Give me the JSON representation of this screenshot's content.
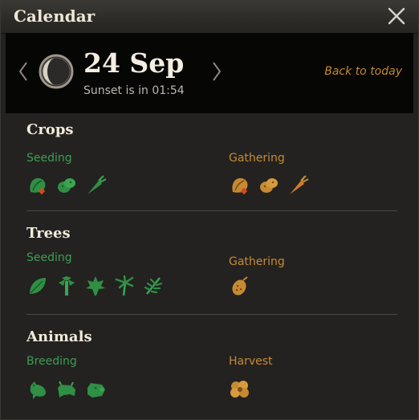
{
  "window": {
    "title": "Calendar"
  },
  "header": {
    "date": "24 Sep",
    "sunset": "Sunset is in 01:54",
    "back_to_today": "Back to today"
  },
  "sections": [
    {
      "title": "Crops",
      "left_label": "Seeding",
      "right_label": "Gathering",
      "left_icons": [
        "lettuce-icon",
        "potato-icon",
        "carrot-icon"
      ],
      "right_icons": [
        "lettuce-icon",
        "potato-icon",
        "carrot-icon"
      ]
    },
    {
      "title": "Trees",
      "left_label": "Seeding",
      "right_label": "Gathering",
      "left_icons": [
        "leaf-icon",
        "birch-icon",
        "maple-leaf-icon",
        "palm-icon",
        "pine-icon"
      ],
      "right_icons": [
        "pinecone-icon"
      ]
    },
    {
      "title": "Animals",
      "left_label": "Breeding",
      "right_label": "Harvest",
      "left_icons": [
        "chicken-icon",
        "cow-icon",
        "pig-icon"
      ],
      "right_icons": [
        "wool-icon"
      ]
    }
  ],
  "colors": {
    "seeding": "#3e9d52",
    "gathering": "#c68a33",
    "accent": "#c48a2c"
  }
}
